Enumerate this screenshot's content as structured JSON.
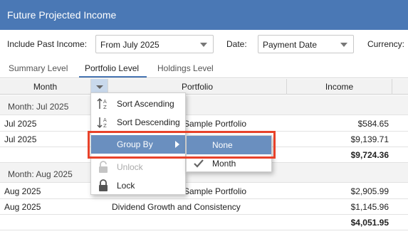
{
  "window": {
    "title": "Future Projected Income"
  },
  "filters": {
    "include_past_label": "Include Past Income:",
    "include_past_value": "From July 2025",
    "date_label": "Date:",
    "date_value": "Payment Date",
    "currency_label": "Currency:"
  },
  "tabs": [
    {
      "label": "Summary Level",
      "active": false
    },
    {
      "label": "Portfolio Level",
      "active": true
    },
    {
      "label": "Holdings Level",
      "active": false
    }
  ],
  "columns": {
    "month": "Month",
    "portfolio": "Portfolio",
    "income": "Income"
  },
  "groups": [
    {
      "header": "Month: Jul 2025",
      "rows": [
        {
          "month": "Jul 2025",
          "portfolio": "Sample Portfolio",
          "income": "$584.65"
        },
        {
          "month": "Jul 2025",
          "portfolio": "",
          "income": "$9,139.71"
        }
      ],
      "total": "$9,724.36"
    },
    {
      "header": "Month: Aug 2025",
      "rows": [
        {
          "month": "Aug 2025",
          "portfolio": "Sample Portfolio",
          "income": "$2,905.99"
        },
        {
          "month": "Aug 2025",
          "portfolio": "Dividend Growth and Consistency",
          "income": "$1,145.96"
        }
      ],
      "total": "$4,051.95"
    }
  ],
  "context_menu": {
    "items": [
      {
        "label": "Sort Ascending",
        "icon": "sort-ascending-icon"
      },
      {
        "label": "Sort Descending",
        "icon": "sort-descending-icon"
      },
      {
        "label": "Group By",
        "icon": "none",
        "highlighted": true
      },
      {
        "label": "Unlock",
        "icon": "unlock-icon",
        "disabled": true
      },
      {
        "label": "Lock",
        "icon": "lock-icon"
      }
    ],
    "submenu": [
      {
        "label": "None",
        "highlighted": true
      },
      {
        "label": "Month",
        "checked": true
      }
    ]
  },
  "colors": {
    "accent": "#4a78b5",
    "highlight": "#6a8fbf",
    "callout": "#e8422a"
  }
}
